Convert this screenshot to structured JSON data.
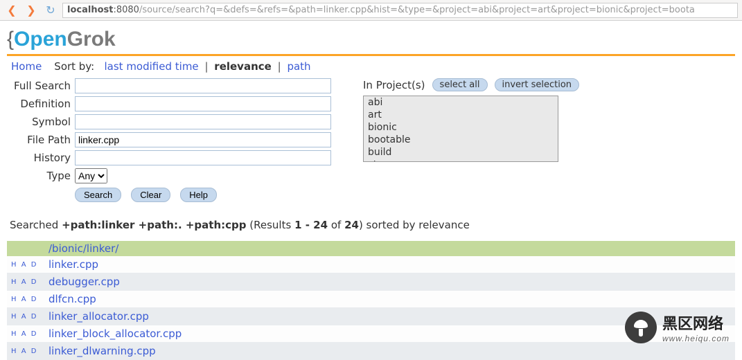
{
  "browser": {
    "url_host": "localhost",
    "url_port": ":8080",
    "url_path": "/source/search?q=&defs=&refs=&path=linker.cpp&hist=&type=&project=abi&project=art&project=bionic&project=boota"
  },
  "logo": {
    "brace": "{",
    "open": "Open",
    "grok": "Grok"
  },
  "toprow": {
    "home": "Home",
    "sortby_label": "Sort by:",
    "sort_time": "last modified time",
    "sort_rel": "relevance",
    "sort_path": "path"
  },
  "form": {
    "full_search": {
      "label": "Full Search",
      "value": ""
    },
    "definition": {
      "label": "Definition",
      "value": ""
    },
    "symbol": {
      "label": "Symbol",
      "value": ""
    },
    "file_path": {
      "label": "File Path",
      "value": "linker.cpp"
    },
    "history": {
      "label": "History",
      "value": ""
    },
    "type": {
      "label": "Type",
      "value": "Any"
    },
    "buttons": {
      "search": "Search",
      "clear": "Clear",
      "help": "Help"
    }
  },
  "projects": {
    "label": "In Project(s)",
    "select_all": "select all",
    "invert": "invert selection",
    "items": [
      "abi",
      "art",
      "bionic",
      "bootable",
      "build",
      "cts"
    ]
  },
  "summary": {
    "prefix": "Searched ",
    "q1": "+path:linker +path:. +path:cpp",
    "mid1": " (Results ",
    "range": "1 - 24",
    "mid2": " of ",
    "total": "24",
    "suffix": ") sorted by relevance"
  },
  "group_path": "/bionic/linker/",
  "had_labels": {
    "h": "H",
    "a": "A",
    "d": "D"
  },
  "results": [
    {
      "file": "linker.cpp"
    },
    {
      "file": "debugger.cpp"
    },
    {
      "file": "dlfcn.cpp"
    },
    {
      "file": "linker_allocator.cpp"
    },
    {
      "file": "linker_block_allocator.cpp"
    },
    {
      "file": "linker_dlwarning.cpp"
    }
  ],
  "watermark": {
    "cn": "黑区网络",
    "url": "www.heiqu.com"
  }
}
